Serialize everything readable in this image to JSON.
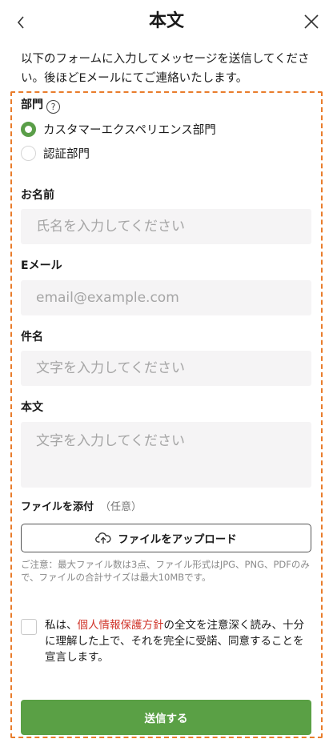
{
  "header": {
    "back_icon": "chevron-left-icon",
    "title": "本文",
    "close_icon": "close-icon"
  },
  "intro_text": "以下のフォームに入力してメッセージを送信してください。後ほどEメールにてご連絡いたします。",
  "department": {
    "label": "部門",
    "help_icon": "question-circle-icon",
    "options": [
      {
        "label": "カスタマーエクスペリエンス部門",
        "selected": true
      },
      {
        "label": "認証部門",
        "selected": false
      }
    ]
  },
  "name_field": {
    "label": "お名前",
    "placeholder": "氏名を入力してください",
    "value": ""
  },
  "email_field": {
    "label": "Eメール",
    "placeholder": "email@example.com",
    "value": ""
  },
  "subject_field": {
    "label": "件名",
    "placeholder": "文字を入力してください",
    "value": ""
  },
  "body_field": {
    "label": "本文",
    "placeholder": "文字を入力してください",
    "value": ""
  },
  "attachment": {
    "label": "ファイルを添付",
    "optional": "（任意）",
    "upload_icon": "cloud-upload-icon",
    "upload_label": "ファイルをアップロード",
    "note": "ご注意：最大ファイル数は3点、ファイル形式はJPG、PNG、PDFのみで、ファイルの合計サイズは最大10MBです。"
  },
  "agreement": {
    "checked": false,
    "text_before": "私は、",
    "link": "個人情報保護方針",
    "text_after": "の全文を注意深く読み、十分に理解した上で、それを完全に受諾、同意することを宣言します。"
  },
  "submit_label": "送信する",
  "colors": {
    "accent_green": "#5aa045",
    "frame_orange": "#e97d2c",
    "link_red": "#d0352b"
  }
}
